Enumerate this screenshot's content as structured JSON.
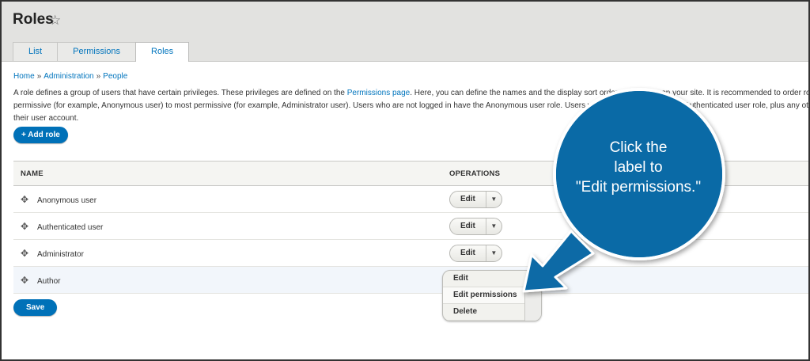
{
  "page": {
    "title": "Roles",
    "star_icon": "star-outline-icon"
  },
  "tabs": [
    {
      "label": "List",
      "active": false
    },
    {
      "label": "Permissions",
      "active": false
    },
    {
      "label": "Roles",
      "active": true
    }
  ],
  "breadcrumb": {
    "items": [
      "Home",
      "Administration",
      "People"
    ],
    "separator": "»"
  },
  "description": {
    "part1": "A role defines a group of users that have certain privileges. These privileges are defined on the ",
    "link": "Permissions page",
    "part2": ". Here, you can define the names and the display sort order of the roles on your site. It is recommended to order roles from least permissive (for example, Anonymous user) to most permissive (for example, Administrator user). Users who are not logged in have the Anonymous user role. Users who are logged in have the Authenticated user role, plus any other roles granted to their user account."
  },
  "add_role_label": "+ Add role",
  "table": {
    "headers": {
      "name": "NAME",
      "operations": "OPERATIONS"
    },
    "rows": [
      {
        "name": "Anonymous user",
        "op": "Edit"
      },
      {
        "name": "Authenticated user",
        "op": "Edit"
      },
      {
        "name": "Administrator",
        "op": "Edit"
      },
      {
        "name": "Author",
        "op": ""
      }
    ]
  },
  "dropdown": {
    "items": [
      "Edit",
      "Edit permissions",
      "Delete"
    ],
    "highlighted": "Edit permissions"
  },
  "save_label": "Save",
  "callout": {
    "lines": [
      "Click the",
      "label to",
      "\"Edit permissions.\""
    ],
    "color": "#0a6aa6"
  },
  "colors": {
    "accent": "#0071b8",
    "link": "#0074bd",
    "header_bg": "#e2e2e0"
  }
}
